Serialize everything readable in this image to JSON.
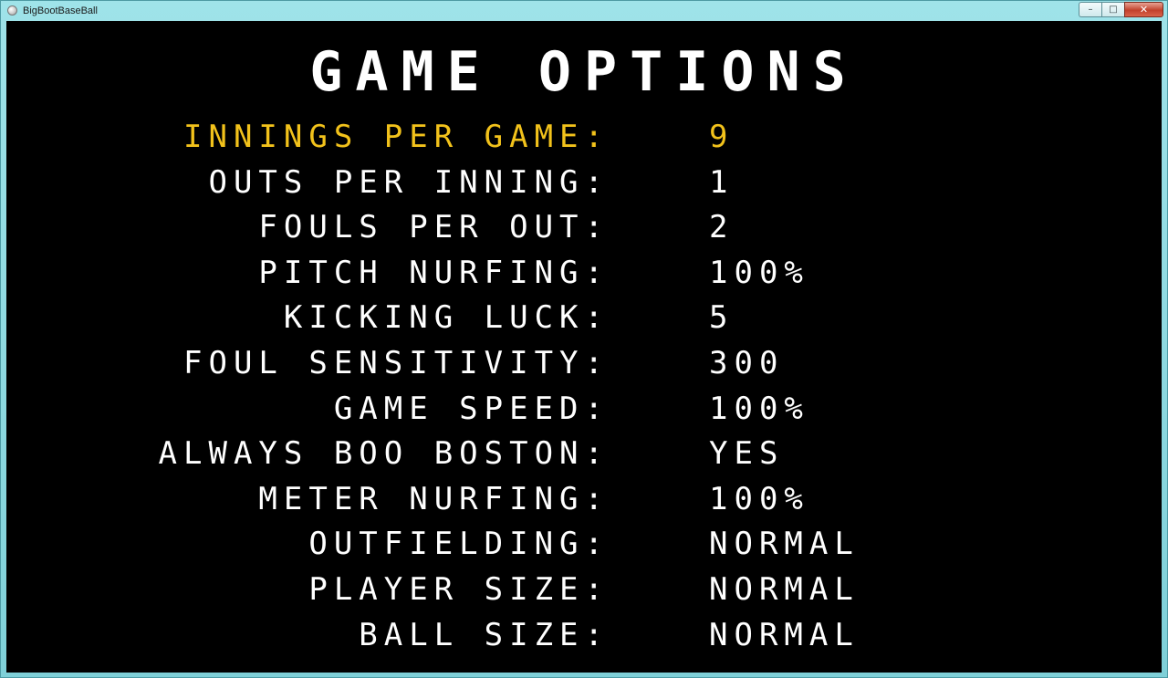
{
  "window": {
    "title": "BigBootBaseBall",
    "controls": {
      "minimize": "–",
      "maximize": "□",
      "close": "✕"
    }
  },
  "screen": {
    "title": "Game Options",
    "selected_color": "#f2c21b",
    "text_color": "#ffffff",
    "background_color": "#000000",
    "options": [
      {
        "label": "Innings per game:",
        "value": "9",
        "selected": true
      },
      {
        "label": "Outs per inning:",
        "value": "1",
        "selected": false
      },
      {
        "label": "Fouls per out:",
        "value": "2",
        "selected": false
      },
      {
        "label": "Pitch nurfing:",
        "value": "100%",
        "selected": false
      },
      {
        "label": "Kicking luck:",
        "value": "5",
        "selected": false
      },
      {
        "label": "Foul sensitivity:",
        "value": "300",
        "selected": false
      },
      {
        "label": "Game Speed:",
        "value": "100%",
        "selected": false
      },
      {
        "label": "Always boo Boston:",
        "value": "Yes",
        "selected": false
      },
      {
        "label": "Meter Nurfing:",
        "value": "100%",
        "selected": false
      },
      {
        "label": "Outfielding:",
        "value": "Normal",
        "selected": false
      },
      {
        "label": "Player Size:",
        "value": "Normal",
        "selected": false
      },
      {
        "label": "Ball Size:",
        "value": "Normal",
        "selected": false
      }
    ]
  }
}
